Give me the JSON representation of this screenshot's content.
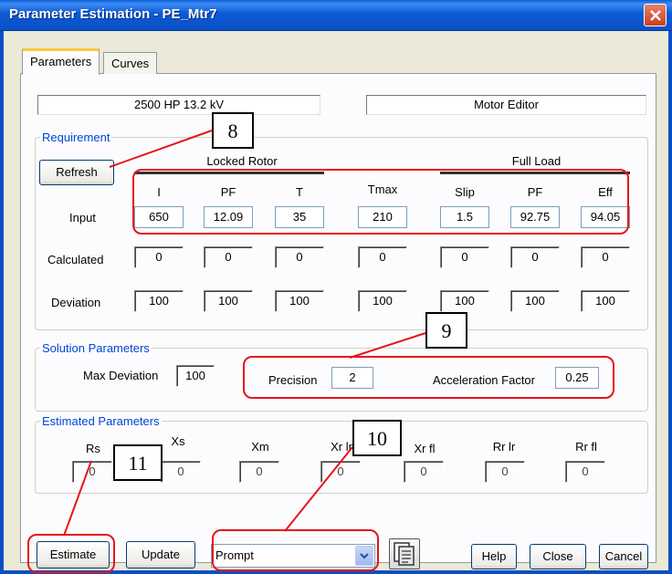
{
  "window": {
    "title": "Parameter Estimation - PE_Mtr7"
  },
  "tabs": [
    {
      "label": "Parameters",
      "active": true
    },
    {
      "label": "Curves",
      "active": false
    }
  ],
  "header": {
    "rating": "2500 HP   13.2 kV",
    "editor": "Motor Editor"
  },
  "requirement": {
    "group_label": "Requirement",
    "refresh_label": "Refresh",
    "locked_rotor_label": "Locked Rotor",
    "full_load_label": "Full Load",
    "columns": [
      "I",
      "PF",
      "T",
      "Tmax",
      "Slip",
      "PF",
      "Eff"
    ],
    "input_label": "Input",
    "inputs": [
      "650",
      "12.09",
      "35",
      "210",
      "1.5",
      "92.75",
      "94.05"
    ],
    "calculated_label": "Calculated",
    "calculated": [
      "0",
      "0",
      "0",
      "0",
      "0",
      "0",
      "0"
    ],
    "deviation_label": "Deviation",
    "deviation": [
      "100",
      "100",
      "100",
      "100",
      "100",
      "100",
      "100"
    ]
  },
  "solution": {
    "group_label": "Solution Parameters",
    "max_deviation_label": "Max Deviation",
    "max_deviation": "100",
    "precision_label": "Precision",
    "precision": "2",
    "acceleration_label": "Acceleration Factor",
    "acceleration": "0.25"
  },
  "estimated": {
    "group_label": "Estimated Parameters",
    "columns": [
      "Rs",
      "Xs",
      "Xm",
      "Xr lr",
      "Xr fl",
      "Rr lr",
      "Rr fl"
    ],
    "values": [
      "0",
      "0",
      "0",
      "0",
      "0",
      "0",
      "0"
    ]
  },
  "footer": {
    "estimate_label": "Estimate",
    "update_label": "Update",
    "mode_select": "Prompt",
    "help_label": "Help",
    "close_label": "Close",
    "cancel_label": "Cancel"
  },
  "annotations": {
    "n8": "8",
    "n9": "9",
    "n10": "10",
    "n11": "11"
  },
  "colors": {
    "annotation_red": "#e8141a",
    "title_bar": "#0a4fc6",
    "dialog_bg": "#ece9d8"
  },
  "icons": {
    "close": "close-icon",
    "dropdown": "chevron-down-icon",
    "library": "library-icon"
  }
}
